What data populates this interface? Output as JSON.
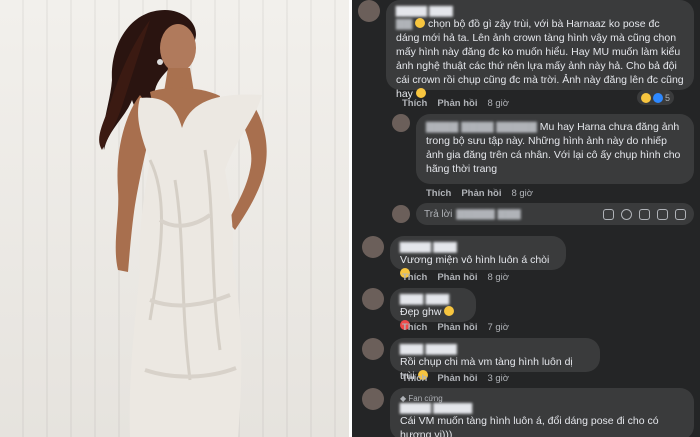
{
  "comments": [
    {
      "text": "chọn bộ đồ gì zậy trùi, với bà Harnaaz ko pose đc dáng mới hả ta. Lên ảnh crown tàng hình vậy mà cũng chọn mấy hình này đăng đc  ko muốn hiểu. Hay MU muốn làm kiểu ảnh nghệ thuật các thứ nên lựa mấy ảnh này hả. Cho bả đội cái crown rồi chụp cũng đc mà trời. Ảnh này đăng lên đc cũng hay ",
      "like": "Thích",
      "reply": "Phản hồi",
      "time": "8 giờ",
      "reactions": "5"
    },
    {
      "text": "Mu hay Harna chưa đăng ảnh trong bộ sưu tập này. Những hình ảnh này do nhiếp ảnh gia đăng trên cá nhân. Với lại cô ấy chụp hình cho hãng thời trang",
      "like": "Thích",
      "reply": "Phản hồi",
      "time": "8 giờ"
    },
    {
      "text": "Vương miện vô hình luôn á chòi ",
      "like": "Thích",
      "reply": "Phản hồi",
      "time": "8 giờ"
    },
    {
      "text": "Đẹp ghw ",
      "like": "Thích",
      "reply": "Phản hồi",
      "time": "7 giờ"
    },
    {
      "text": "Rồi chụp chi mà vm tàng hình luôn dị trùi ",
      "like": "Thích",
      "reply": "Phản hồi",
      "time": "3 giờ"
    },
    {
      "badge": "Fan cứng",
      "text": "Cái VM muốn tàng hình luôn á, đổi dáng pose đi cho có hương vị)))"
    }
  ],
  "reply_box": {
    "prefix": "Trả lời"
  },
  "colors": {
    "panel_bg": "#242526",
    "bubble_bg": "#3a3b3c",
    "text": "#e4e6eb",
    "muted": "#b0b3b8"
  }
}
